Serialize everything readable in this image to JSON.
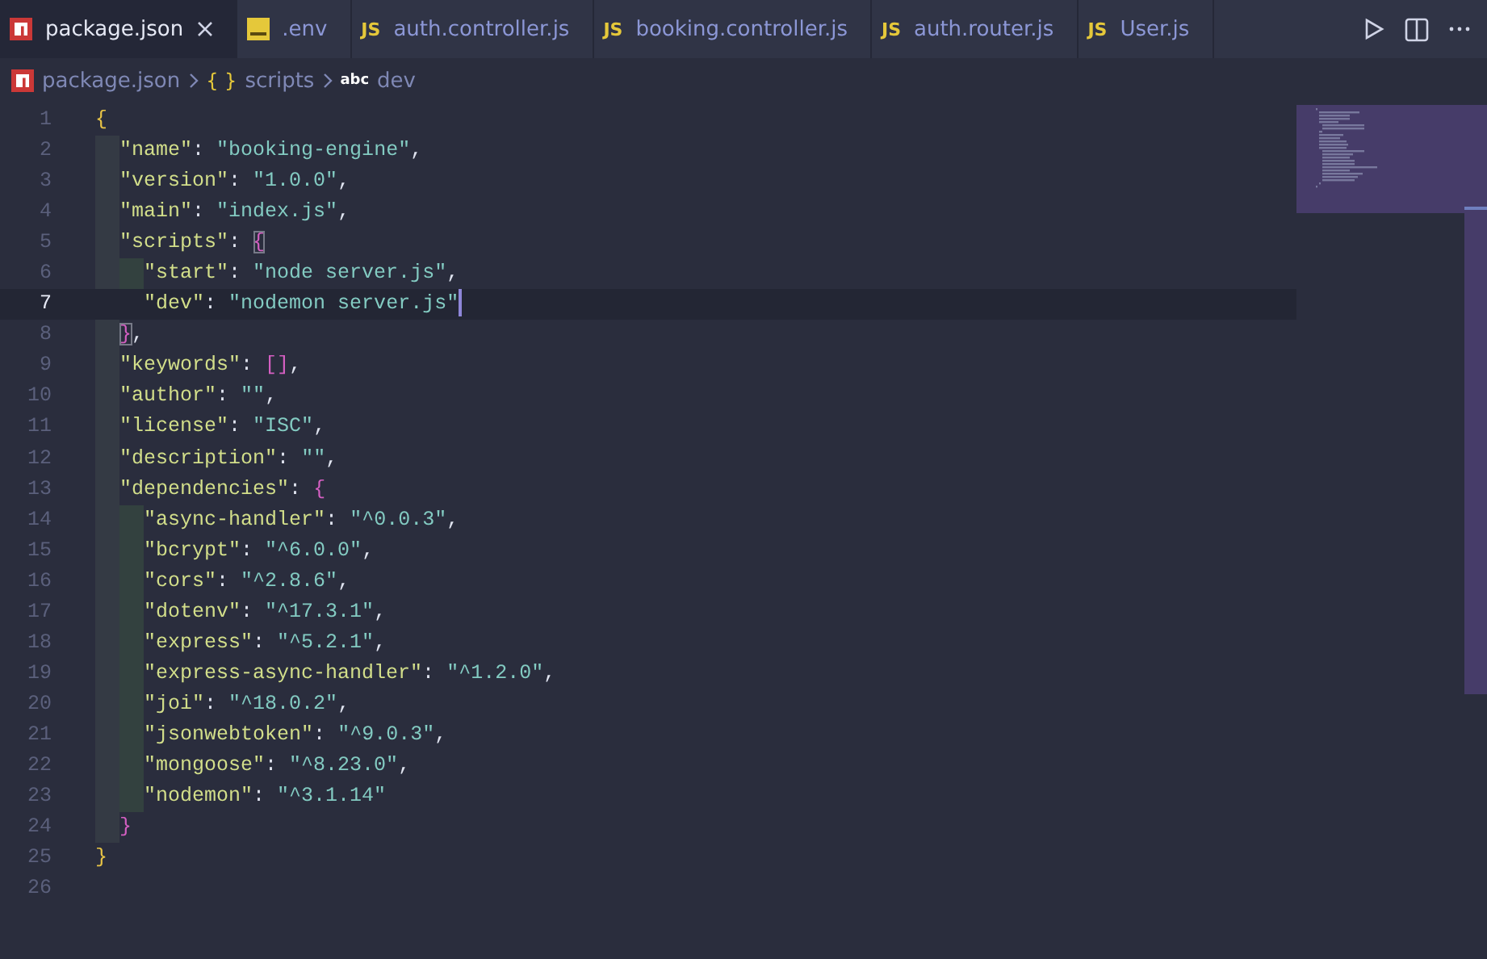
{
  "tabs": [
    {
      "label": "package.json",
      "kind": "npm",
      "selected": true
    },
    {
      "label": ".env",
      "kind": "env",
      "selected": false
    },
    {
      "label": "auth.controller.js",
      "kind": "js",
      "icon_text": "JS",
      "selected": false
    },
    {
      "label": "booking.controller.js",
      "kind": "js",
      "icon_text": "JS",
      "selected": false
    },
    {
      "label": "auth.router.js",
      "kind": "js",
      "icon_text": "JS",
      "selected": false
    },
    {
      "label": "User.js",
      "kind": "js",
      "icon_text": "JS",
      "selected": false
    }
  ],
  "breadcrumb": [
    {
      "kind": "npm",
      "label": "package.json"
    },
    {
      "kind": "object",
      "icon_text": "{ }",
      "label": "scripts"
    },
    {
      "kind": "string",
      "icon_text": "abc",
      "label": "dev"
    }
  ],
  "editor": {
    "lines": [
      {
        "number": "1",
        "current": false,
        "tokens": [
          {
            "kind": "brace1",
            "text": "{"
          }
        ]
      },
      {
        "number": "2",
        "current": false,
        "tokens": [
          {
            "kind": "key",
            "text": "  \"name\""
          },
          {
            "kind": "punct",
            "text": ": "
          },
          {
            "kind": "string",
            "text": "\"booking-engine\""
          },
          {
            "kind": "punct",
            "text": ","
          }
        ]
      },
      {
        "number": "3",
        "current": false,
        "tokens": [
          {
            "kind": "key",
            "text": "  \"version\""
          },
          {
            "kind": "punct",
            "text": ": "
          },
          {
            "kind": "string",
            "text": "\"1.0.0\""
          },
          {
            "kind": "punct",
            "text": ","
          }
        ]
      },
      {
        "number": "4",
        "current": false,
        "tokens": [
          {
            "kind": "key",
            "text": "  \"main\""
          },
          {
            "kind": "punct",
            "text": ": "
          },
          {
            "kind": "string",
            "text": "\"index.js\""
          },
          {
            "kind": "punct",
            "text": ","
          }
        ]
      },
      {
        "number": "5",
        "current": false,
        "tokens": [
          {
            "kind": "key",
            "text": "  \"scripts\""
          },
          {
            "kind": "punct",
            "text": ": "
          },
          {
            "kind": "brace2",
            "text": "{",
            "matched": true
          }
        ]
      },
      {
        "number": "6",
        "current": false,
        "tokens": [
          {
            "kind": "key",
            "text": "    \"start\""
          },
          {
            "kind": "punct",
            "text": ": "
          },
          {
            "kind": "string",
            "text": "\"node server.js\""
          },
          {
            "kind": "punct",
            "text": ","
          }
        ]
      },
      {
        "number": "7",
        "current": true,
        "tokens": [
          {
            "kind": "key",
            "text": "    \"dev\""
          },
          {
            "kind": "punct",
            "text": ": "
          },
          {
            "kind": "string",
            "text": "\"nodemon server.js\""
          }
        ]
      },
      {
        "number": "8",
        "current": false,
        "tokens": [
          {
            "kind": "brace2",
            "text": "  }",
            "matched": true
          },
          {
            "kind": "punct",
            "text": ","
          }
        ]
      },
      {
        "number": "9",
        "current": false,
        "tokens": [
          {
            "kind": "key",
            "text": "  \"keywords\""
          },
          {
            "kind": "punct",
            "text": ": "
          },
          {
            "kind": "brace2",
            "text": "[]"
          },
          {
            "kind": "punct",
            "text": ","
          }
        ]
      },
      {
        "number": "10",
        "current": false,
        "tokens": [
          {
            "kind": "key",
            "text": "  \"author\""
          },
          {
            "kind": "punct",
            "text": ": "
          },
          {
            "kind": "string",
            "text": "\"\""
          },
          {
            "kind": "punct",
            "text": ","
          }
        ]
      },
      {
        "number": "11",
        "current": false,
        "tokens": [
          {
            "kind": "key",
            "text": "  \"license\""
          },
          {
            "kind": "punct",
            "text": ": "
          },
          {
            "kind": "string",
            "text": "\"ISC\""
          },
          {
            "kind": "punct",
            "text": ","
          }
        ]
      },
      {
        "number": "12",
        "current": false,
        "tokens": [
          {
            "kind": "key",
            "text": "  \"description\""
          },
          {
            "kind": "punct",
            "text": ": "
          },
          {
            "kind": "string",
            "text": "\"\""
          },
          {
            "kind": "punct",
            "text": ","
          }
        ]
      },
      {
        "number": "13",
        "current": false,
        "tokens": [
          {
            "kind": "key",
            "text": "  \"dependencies\""
          },
          {
            "kind": "punct",
            "text": ": "
          },
          {
            "kind": "brace2",
            "text": "{"
          }
        ]
      },
      {
        "number": "14",
        "current": false,
        "tokens": [
          {
            "kind": "key",
            "text": "    \"async-handler\""
          },
          {
            "kind": "punct",
            "text": ": "
          },
          {
            "kind": "string",
            "text": "\"^0.0.3\""
          },
          {
            "kind": "punct",
            "text": ","
          }
        ]
      },
      {
        "number": "15",
        "current": false,
        "tokens": [
          {
            "kind": "key",
            "text": "    \"bcrypt\""
          },
          {
            "kind": "punct",
            "text": ": "
          },
          {
            "kind": "string",
            "text": "\"^6.0.0\""
          },
          {
            "kind": "punct",
            "text": ","
          }
        ]
      },
      {
        "number": "16",
        "current": false,
        "tokens": [
          {
            "kind": "key",
            "text": "    \"cors\""
          },
          {
            "kind": "punct",
            "text": ": "
          },
          {
            "kind": "string",
            "text": "\"^2.8.6\""
          },
          {
            "kind": "punct",
            "text": ","
          }
        ]
      },
      {
        "number": "17",
        "current": false,
        "tokens": [
          {
            "kind": "key",
            "text": "    \"dotenv\""
          },
          {
            "kind": "punct",
            "text": ": "
          },
          {
            "kind": "string",
            "text": "\"^17.3.1\""
          },
          {
            "kind": "punct",
            "text": ","
          }
        ]
      },
      {
        "number": "18",
        "current": false,
        "tokens": [
          {
            "kind": "key",
            "text": "    \"express\""
          },
          {
            "kind": "punct",
            "text": ": "
          },
          {
            "kind": "string",
            "text": "\"^5.2.1\""
          },
          {
            "kind": "punct",
            "text": ","
          }
        ]
      },
      {
        "number": "19",
        "current": false,
        "tokens": [
          {
            "kind": "key",
            "text": "    \"express-async-handler\""
          },
          {
            "kind": "punct",
            "text": ": "
          },
          {
            "kind": "string",
            "text": "\"^1.2.0\""
          },
          {
            "kind": "punct",
            "text": ","
          }
        ]
      },
      {
        "number": "20",
        "current": false,
        "tokens": [
          {
            "kind": "key",
            "text": "    \"joi\""
          },
          {
            "kind": "punct",
            "text": ": "
          },
          {
            "kind": "string",
            "text": "\"^18.0.2\""
          },
          {
            "kind": "punct",
            "text": ","
          }
        ]
      },
      {
        "number": "21",
        "current": false,
        "tokens": [
          {
            "kind": "key",
            "text": "    \"jsonwebtoken\""
          },
          {
            "kind": "punct",
            "text": ": "
          },
          {
            "kind": "string",
            "text": "\"^9.0.3\""
          },
          {
            "kind": "punct",
            "text": ","
          }
        ]
      },
      {
        "number": "22",
        "current": false,
        "tokens": [
          {
            "kind": "key",
            "text": "    \"mongoose\""
          },
          {
            "kind": "punct",
            "text": ": "
          },
          {
            "kind": "string",
            "text": "\"^8.23.0\""
          },
          {
            "kind": "punct",
            "text": ","
          }
        ]
      },
      {
        "number": "23",
        "current": false,
        "tokens": [
          {
            "kind": "key",
            "text": "    \"nodemon\""
          },
          {
            "kind": "punct",
            "text": ": "
          },
          {
            "kind": "string",
            "text": "\"^3.1.14\""
          }
        ]
      },
      {
        "number": "24",
        "current": false,
        "tokens": [
          {
            "kind": "brace2",
            "text": "  }"
          }
        ]
      },
      {
        "number": "25",
        "current": false,
        "tokens": [
          {
            "kind": "brace1",
            "text": "}"
          }
        ]
      },
      {
        "number": "26",
        "current": false
      }
    ]
  }
}
